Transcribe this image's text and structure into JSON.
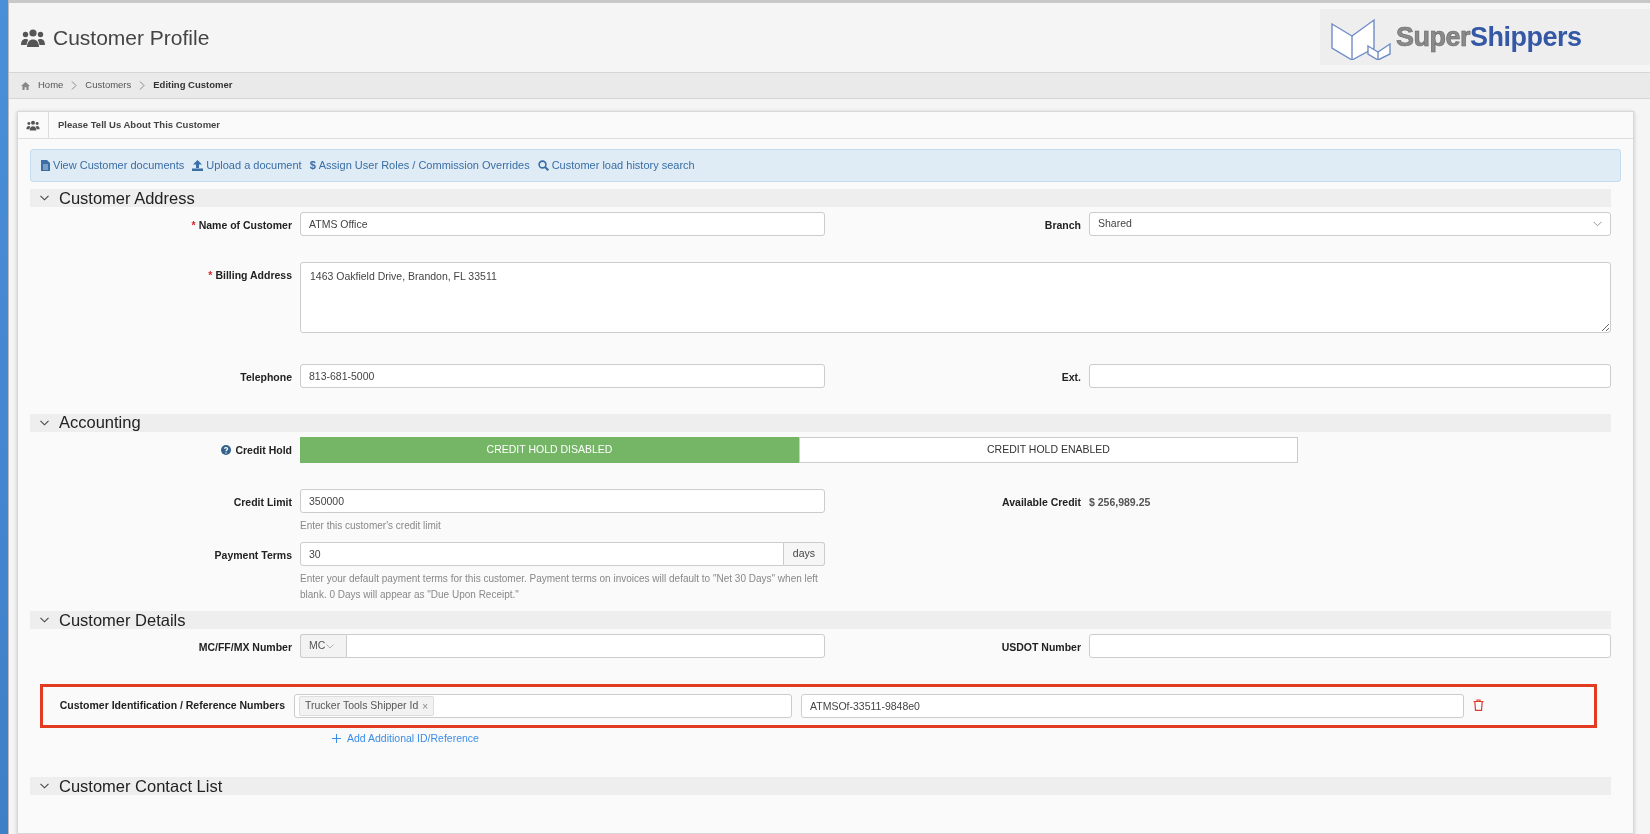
{
  "page_title": "Customer Profile",
  "logo": {
    "light": "Super",
    "bold": "Shippers"
  },
  "breadcrumb": [
    {
      "label": "Home",
      "current": false
    },
    {
      "label": "Customers",
      "current": false
    },
    {
      "label": "Editing Customer",
      "current": true
    }
  ],
  "panel": {
    "title": "Please Tell Us About This Customer"
  },
  "links": [
    {
      "kind": "document",
      "label": "View Customer documents"
    },
    {
      "kind": "upload",
      "label": "Upload a document"
    },
    {
      "kind": "dollar",
      "symbol": "$",
      "label": "Assign User Roles / Commission Overrides"
    },
    {
      "kind": "search",
      "label": "Customer load history search"
    }
  ],
  "sections": [
    {
      "title": "Customer Address",
      "expanded": true,
      "rows": [
        {
          "fields": [
            {
              "kind": "text",
              "label": "Name of Customer",
              "required_mark": "*",
              "value": "ATMS Office"
            },
            {
              "kind": "select",
              "label": "Branch",
              "value": "Shared"
            }
          ]
        },
        {
          "fields": [
            {
              "kind": "textarea",
              "label": "Billing Address",
              "required_mark": "*",
              "value": "1463 Oakfield Drive, Brandon, FL 33511"
            }
          ]
        },
        {
          "fields": [
            {
              "kind": "text",
              "label": "Telephone",
              "value": "813-681-5000"
            },
            {
              "kind": "text",
              "label": "Ext."
            }
          ]
        }
      ]
    },
    {
      "title": "Accounting",
      "expanded": true,
      "rows": [
        {
          "fields": [
            {
              "kind": "toggle",
              "label": "Credit Hold",
              "help": true,
              "options": [
                {
                  "label": "CREDIT HOLD DISABLED",
                  "selected": true
                },
                {
                  "label": "CREDIT HOLD ENABLED",
                  "selected": false
                }
              ]
            }
          ]
        },
        {
          "fields": [
            {
              "kind": "text",
              "label": "Credit Limit",
              "value": "350000",
              "hint": "Enter this customer's credit limit"
            },
            {
              "kind": "static",
              "label": "Available Credit",
              "value": "$ 256,989.25"
            }
          ]
        },
        {
          "fields": [
            {
              "kind": "addon",
              "label": "Payment Terms",
              "value": "30",
              "addon": "days",
              "hint": "Enter your default payment terms for this customer. Payment terms on invoices will default to \"Net 30 Days\" when left blank. 0 Days will appear as \"Due Upon Receipt.\""
            }
          ]
        }
      ]
    },
    {
      "title": "Customer Details",
      "expanded": true,
      "rows": [
        {
          "fields": [
            {
              "kind": "prefix",
              "label": "MC/FF/MX Number",
              "prefix": "MC"
            },
            {
              "kind": "text",
              "label": "USDOT Number"
            }
          ]
        },
        {
          "fields": [
            {
              "kind": "reference",
              "label": "Customer Identification / Reference Numbers",
              "highlighted": true,
              "tags": [
                {
                  "label": "Trucker Tools Shipper Id",
                  "remove": "×"
                }
              ],
              "value": "ATMSOf-33511-9848e0",
              "add_link": "Add Additional ID/Reference"
            }
          ]
        }
      ]
    },
    {
      "title": "Customer Contact List",
      "expanded": true
    }
  ]
}
